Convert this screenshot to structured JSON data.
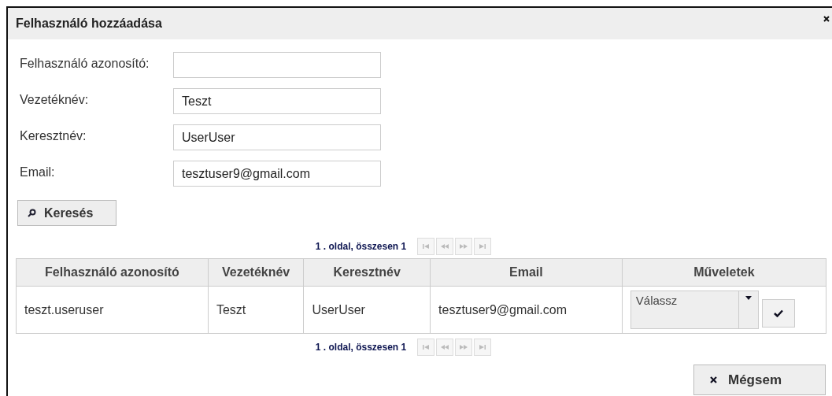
{
  "dialog": {
    "title": "Felhasználó hozzáadása"
  },
  "form": [
    {
      "label": "Felhasználó azonosító:"
    },
    {
      "label": "Vezetéknév:",
      "value": "Teszt"
    },
    {
      "label": "Keresztnév:",
      "value": "UserUser"
    },
    {
      "label": "Email:",
      "value": "tesztuser9@gmail.com"
    }
  ],
  "search_button": "Keresés",
  "pagers": [
    {
      "text": "1 . oldal, összesen 1",
      "buttons": [
        {
          "kind": "first",
          "disabled": true
        },
        {
          "kind": "prev",
          "disabled": true
        },
        {
          "kind": "next",
          "disabled": true
        },
        {
          "kind": "last",
          "disabled": true
        }
      ]
    },
    {
      "text": "1 . oldal, összesen 1",
      "buttons": [
        {
          "kind": "first",
          "disabled": true
        },
        {
          "kind": "prev",
          "disabled": true
        },
        {
          "kind": "next",
          "disabled": true
        },
        {
          "kind": "last",
          "disabled": true
        }
      ]
    }
  ],
  "table": {
    "columns": [
      "Felhasználó azonosító",
      "Vezetéknév",
      "Keresztnév",
      "Email",
      "Műveletek"
    ],
    "rows": [
      {
        "cells": [
          "teszt.useruser",
          "Teszt",
          "UserUser",
          "tesztuser9@gmail.com"
        ],
        "action": "Válassz"
      }
    ]
  },
  "cancel_button": "Mégsem"
}
